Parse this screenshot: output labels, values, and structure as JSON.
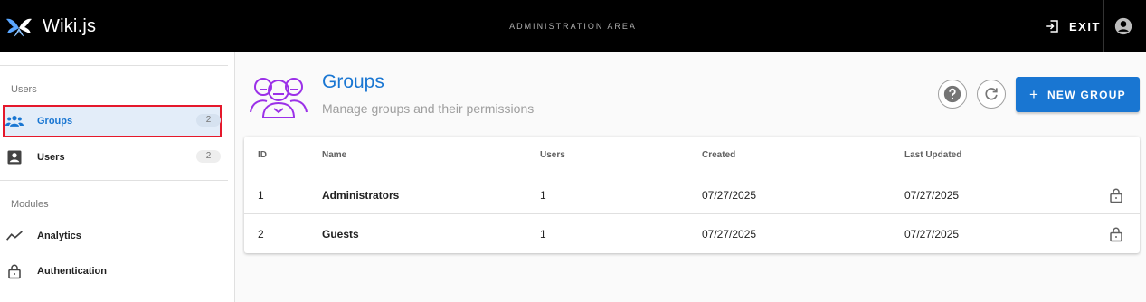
{
  "app": {
    "title": "Wiki.js",
    "area_label": "ADMINISTRATION AREA",
    "exit_label": "EXIT"
  },
  "sidebar": {
    "sections": [
      {
        "header": "Users",
        "items": [
          {
            "label": "Groups",
            "count": "2",
            "icon": "people-icon",
            "active": true
          },
          {
            "label": "Users",
            "count": "2",
            "icon": "account-box-icon",
            "active": false
          }
        ]
      },
      {
        "header": "Modules",
        "items": [
          {
            "label": "Analytics",
            "icon": "chart-line-icon"
          },
          {
            "label": "Authentication",
            "icon": "lock-icon"
          }
        ]
      }
    ]
  },
  "page": {
    "title": "Groups",
    "subtitle": "Manage groups and their permissions",
    "new_group_label": "NEW GROUP"
  },
  "table": {
    "columns": [
      "ID",
      "Name",
      "Users",
      "Created",
      "Last Updated"
    ],
    "rows": [
      {
        "id": "1",
        "name": "Administrators",
        "users": "1",
        "created": "07/27/2025",
        "updated": "07/27/2025"
      },
      {
        "id": "2",
        "name": "Guests",
        "users": "1",
        "created": "07/27/2025",
        "updated": "07/27/2025"
      }
    ]
  },
  "colors": {
    "accent": "#1976d2",
    "topbar": "#000000",
    "highlight_outline": "#e5182b",
    "hero_icon": "#9b30e8"
  }
}
